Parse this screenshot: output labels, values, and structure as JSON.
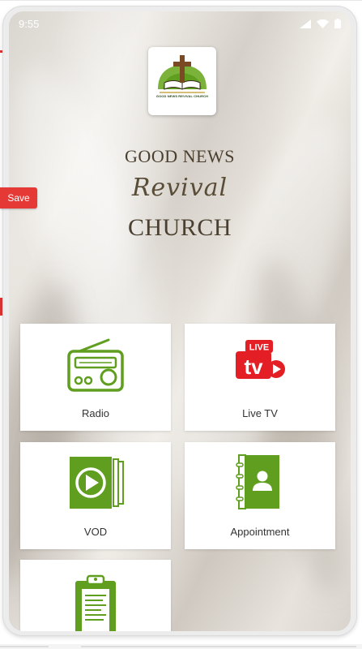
{
  "status_bar": {
    "time": "9:55"
  },
  "logo": {
    "caption": "GOOD NEWS REVIVAL CHURCH"
  },
  "brand": {
    "line1": "GOOD NEWS",
    "line2": "Revival",
    "line3": "CHURCH"
  },
  "tiles": [
    {
      "label": "Radio",
      "icon": "radio-icon"
    },
    {
      "label": "Live TV",
      "icon": "live-tv-icon",
      "badge_top": "LIVE",
      "badge_bottom": "tv"
    },
    {
      "label": "VOD",
      "icon": "video-play-icon"
    },
    {
      "label": "Appointment",
      "icon": "contact-book-icon"
    },
    {
      "label": "",
      "icon": "clipboard-icon"
    }
  ],
  "save_button": {
    "label": "Save"
  },
  "colors": {
    "accent_green": "#5f9e1e",
    "save_red": "#e53935",
    "live_red": "#e31e24"
  }
}
